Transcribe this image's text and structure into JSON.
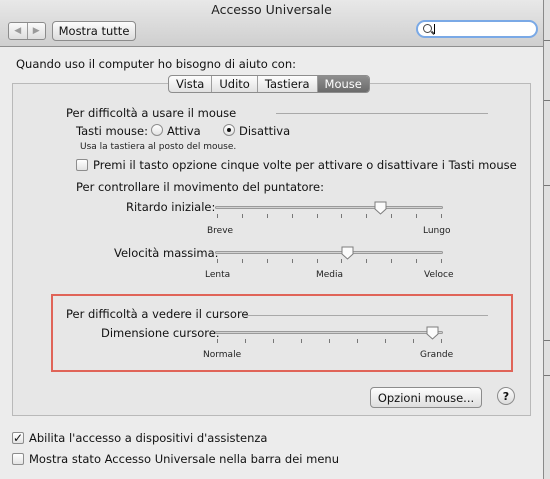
{
  "window": {
    "title": "Accesso Universale"
  },
  "toolbar": {
    "back_icon": "back-arrow-icon",
    "forward_icon": "forward-arrow-icon",
    "show_all_label": "Mostra tutte",
    "search_value": "",
    "search_icon": "magnifier-icon"
  },
  "prompt_label": "Quando uso il computer ho bisogno di aiuto con:",
  "tabs": [
    {
      "label": "Vista",
      "active": false
    },
    {
      "label": "Udito",
      "active": false
    },
    {
      "label": "Tastiera",
      "active": false
    },
    {
      "label": "Mouse",
      "active": true
    }
  ],
  "mouse_section": {
    "title": "Per difficoltà a usare il mouse",
    "keys_label": "Tasti mouse:",
    "radio_on_label": "Attiva",
    "radio_off_label": "Disattiva",
    "selected": "Disattiva",
    "keys_hint": "Usa la tastiera al posto del mouse.",
    "option_checkbox_label": "Premi il tasto opzione cinque volte per attivare o disattivare i Tasti mouse",
    "option_checkbox_checked": false,
    "pointer_title": "Per controllare il movimento del puntatore:",
    "initial_delay": {
      "label": "Ritardo iniziale:",
      "min_label": "Breve",
      "max_label": "Lungo",
      "value": 0.74,
      "ticks": 10
    },
    "max_speed": {
      "label": "Velocità massima:",
      "min_label": "Lenta",
      "mid_label": "Media",
      "max_label": "Veloce",
      "value": 0.59,
      "ticks": 10
    }
  },
  "cursor_section": {
    "title": "Per difficoltà a vedere il cursore",
    "size": {
      "label": "Dimensione cursore:",
      "min_label": "Normale",
      "max_label": "Grande",
      "value": 0.98,
      "ticks": 9
    },
    "highlight_color": "#e06458"
  },
  "mouse_options_button": "Opzioni mouse...",
  "help_label": "?",
  "bottom": {
    "assistive_label": "Abilita l'accesso a dispositivi d'assistenza",
    "assistive_checked": true,
    "menubar_label": "Mostra stato Accesso Universale nella barra dei menu",
    "menubar_checked": false
  },
  "colors": {
    "selected_tab": "#7a7a7a",
    "search_focus": "#7aa9e6"
  }
}
